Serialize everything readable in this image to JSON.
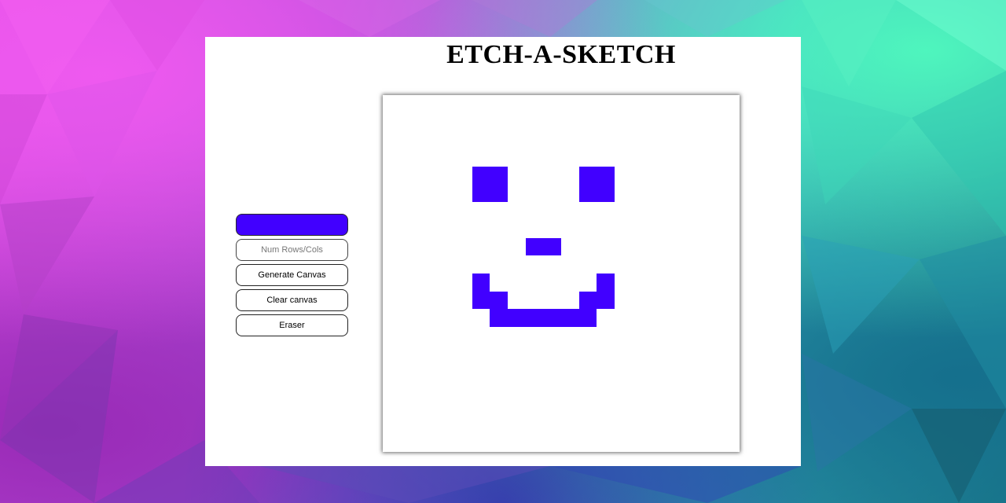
{
  "page": {
    "title": "ETCH-A-SKETCH"
  },
  "controls": {
    "color_value": "#4100ff",
    "size_placeholder": "Num Rows/Cols",
    "size_value": "",
    "generate_label": "Generate Canvas",
    "clear_label": "Clear canvas",
    "eraser_label": "Eraser"
  },
  "canvas": {
    "grid_size": 20,
    "paint_color": "#4100ff",
    "background_color": "#ffffff",
    "filled_cells": [
      [
        4,
        5
      ],
      [
        4,
        6
      ],
      [
        5,
        5
      ],
      [
        5,
        6
      ],
      [
        4,
        11
      ],
      [
        4,
        12
      ],
      [
        5,
        11
      ],
      [
        5,
        12
      ],
      [
        8,
        8
      ],
      [
        8,
        9
      ],
      [
        10,
        5
      ],
      [
        11,
        5
      ],
      [
        11,
        6
      ],
      [
        12,
        6
      ],
      [
        12,
        7
      ],
      [
        12,
        8
      ],
      [
        12,
        9
      ],
      [
        12,
        10
      ],
      [
        12,
        11
      ],
      [
        11,
        11
      ],
      [
        11,
        12
      ],
      [
        10,
        12
      ]
    ]
  }
}
